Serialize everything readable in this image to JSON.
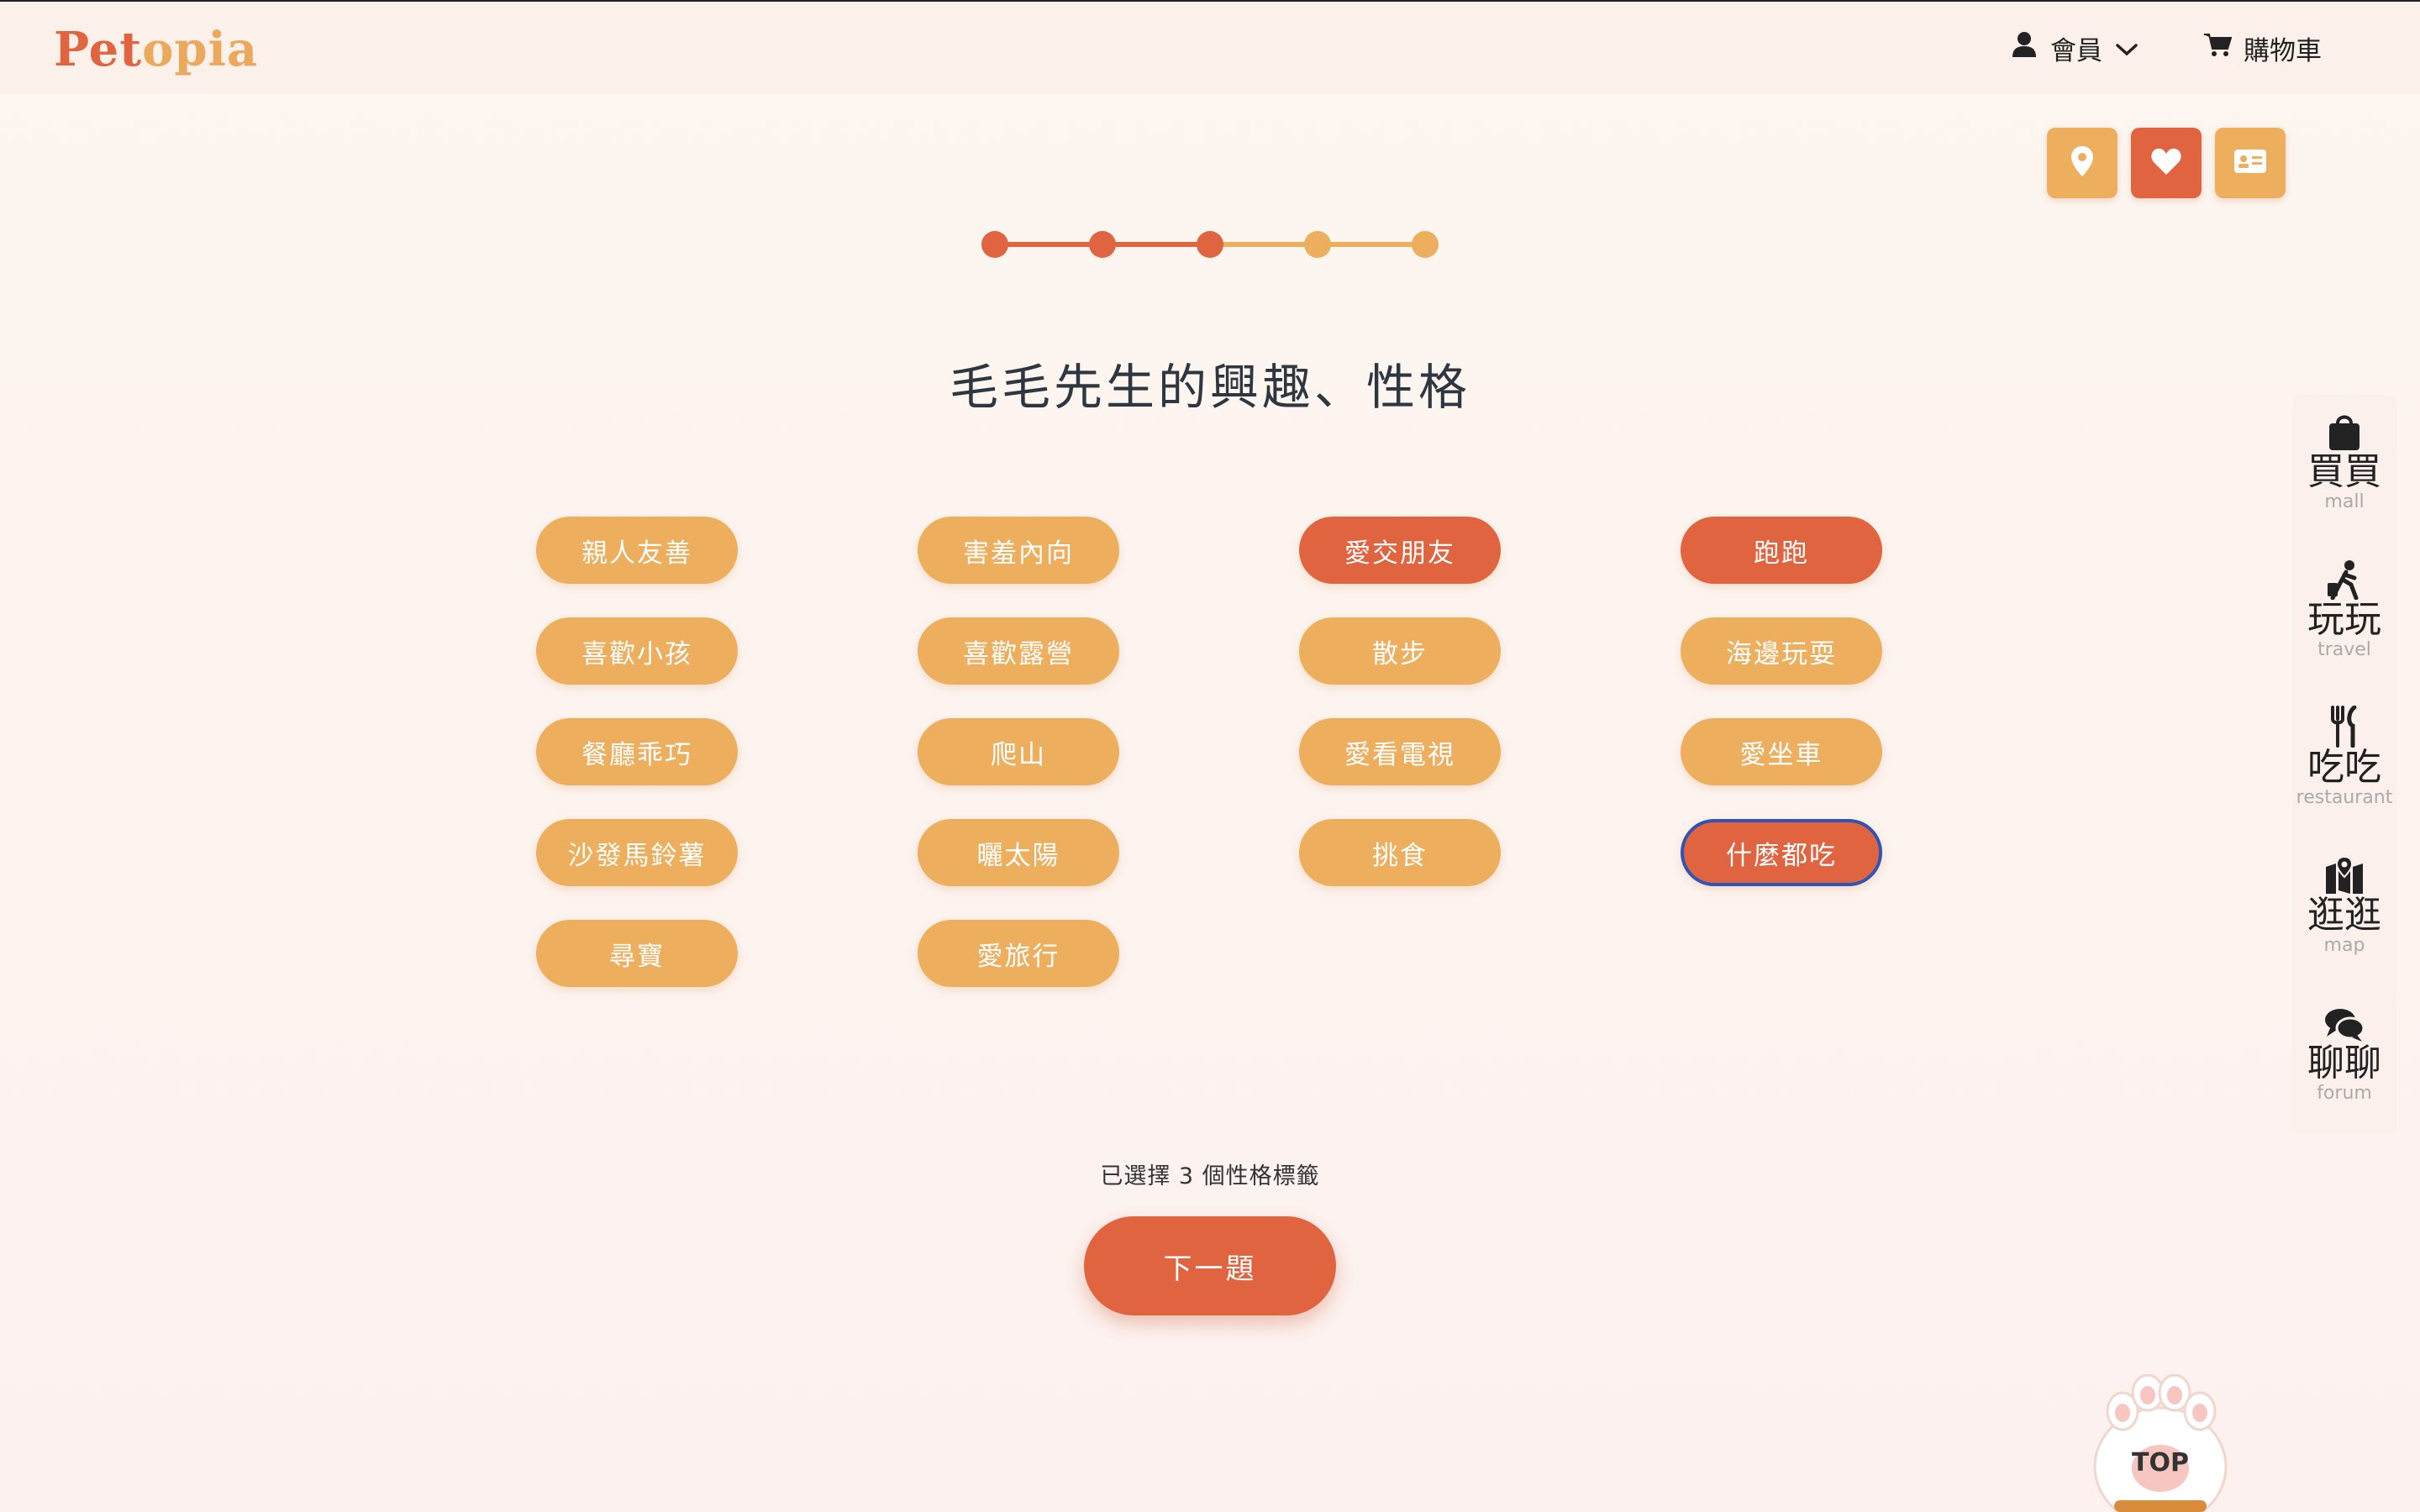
{
  "brand": {
    "part1": "Pet",
    "part2": "opia"
  },
  "nav": {
    "member_label": "會員",
    "cart_label": "購物車"
  },
  "quick_actions": [
    {
      "icon": "location-pin-icon",
      "active": false
    },
    {
      "icon": "heart-icon",
      "active": true
    },
    {
      "icon": "id-card-icon",
      "active": false
    }
  ],
  "progress": {
    "total_steps": 5,
    "completed_steps": 3
  },
  "question": {
    "title": "毛毛先生的興趣、性格"
  },
  "tags": [
    {
      "label": "親人友善",
      "selected": false
    },
    {
      "label": "害羞內向",
      "selected": false
    },
    {
      "label": "愛交朋友",
      "selected": true
    },
    {
      "label": "跑跑",
      "selected": true
    },
    {
      "label": "喜歡小孩",
      "selected": false
    },
    {
      "label": "喜歡露營",
      "selected": false
    },
    {
      "label": "散步",
      "selected": false
    },
    {
      "label": "海邊玩耍",
      "selected": false
    },
    {
      "label": "餐廳乖巧",
      "selected": false
    },
    {
      "label": "爬山",
      "selected": false
    },
    {
      "label": "愛看電視",
      "selected": false
    },
    {
      "label": "愛坐車",
      "selected": false
    },
    {
      "label": "沙發馬鈴薯",
      "selected": false
    },
    {
      "label": "曬太陽",
      "selected": false
    },
    {
      "label": "挑食",
      "selected": false
    },
    {
      "label": "什麼都吃",
      "selected": true,
      "focused": true
    },
    {
      "label": "尋寶",
      "selected": false
    },
    {
      "label": "愛旅行",
      "selected": false
    }
  ],
  "selection": {
    "count_text": "已選擇 3 個性格標籤"
  },
  "actions": {
    "next_label": "下一題"
  },
  "sidebar": {
    "items": [
      {
        "zh": "買買",
        "en": "mall",
        "icon": "shopping-bag-icon"
      },
      {
        "zh": "玩玩",
        "en": "travel",
        "icon": "traveler-icon"
      },
      {
        "zh": "吃吃",
        "en": "restaurant",
        "icon": "utensils-icon"
      },
      {
        "zh": "逛逛",
        "en": "map",
        "icon": "map-icon"
      },
      {
        "zh": "聊聊",
        "en": "forum",
        "icon": "chat-icon"
      }
    ]
  },
  "back_to_top": {
    "label": "TOP"
  },
  "colors": {
    "primary": "#e0643f",
    "secondary": "#edae5e",
    "background": "#fdf5f1",
    "focus_ring": "#2f54b3"
  }
}
